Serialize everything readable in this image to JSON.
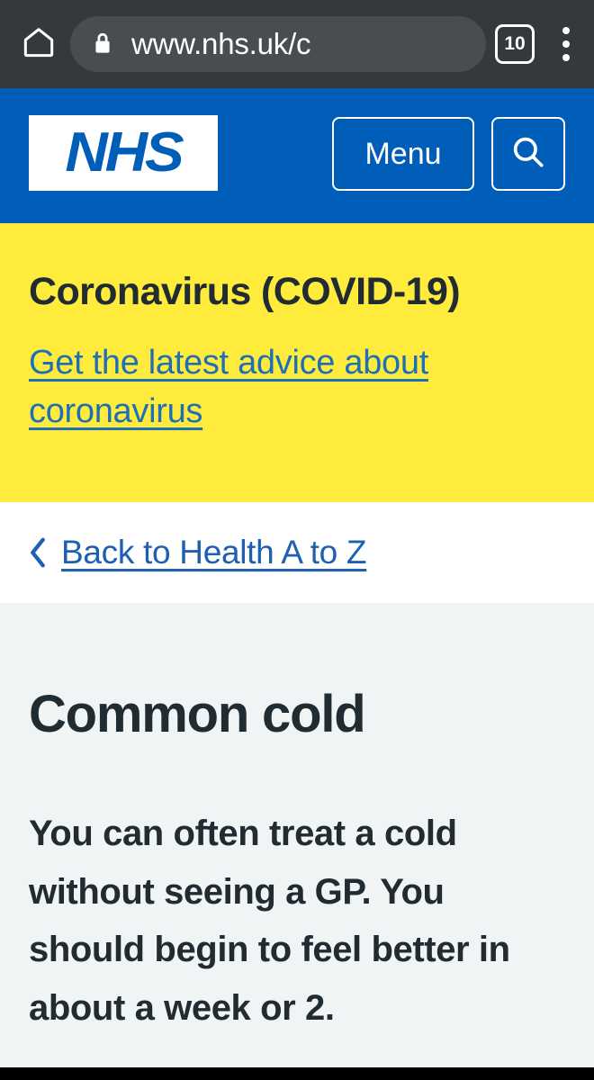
{
  "browser": {
    "home_icon": "home-icon",
    "lock_icon": "lock-icon",
    "url": "www.nhs.uk/c",
    "url_placeholder": "Search or type web address",
    "tab_count": "10",
    "overflow_icon": "three-dots-icon"
  },
  "site_header": {
    "logo_text": "NHS",
    "menu_label": "Menu",
    "search_icon": "search-icon",
    "brand_color": "#005eb8"
  },
  "covid_banner": {
    "title": "Coronavirus (COVID-19)",
    "link_text": "Get the latest advice about coronavirus",
    "background_color": "#ffeb3b",
    "link_color": "#1d70b8"
  },
  "breadcrumb": {
    "chevron_icon": "chevron-left-icon",
    "back_label": "Back to Health A to Z"
  },
  "article": {
    "title": "Common cold",
    "lead": "You can often treat a cold without seeing a GP. You should begin to feel better in about a week or 2.",
    "background_color": "#f0f4f5",
    "text_color": "#212b32"
  }
}
